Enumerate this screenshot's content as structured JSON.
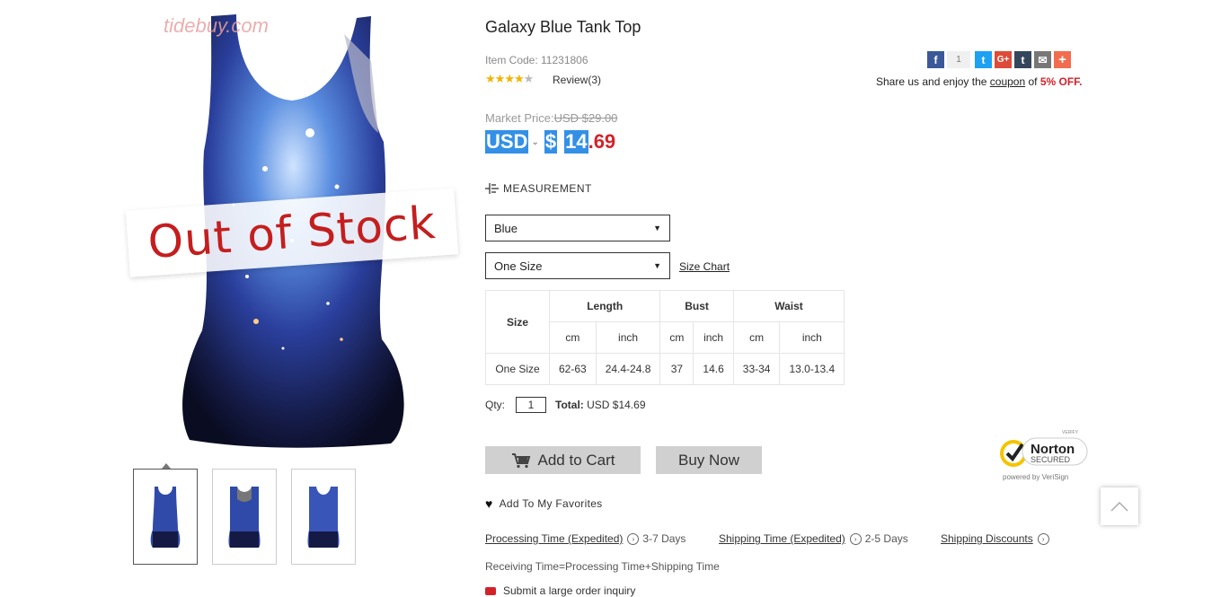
{
  "product": {
    "title": "Galaxy Blue Tank Top",
    "item_code": "Item Code: 11231806",
    "review_label": "Review(3)",
    "rating": 4,
    "rating_max": 5,
    "watermark": "tidebuy.com",
    "stock_banner": "Out of Stock"
  },
  "price": {
    "market_label": "Market Price:",
    "market_value": "USD $29.00",
    "currency": "USD",
    "symbol": "$",
    "integer": "14",
    "decimal": ".69",
    "accent_color": "#d2232a"
  },
  "measurement": {
    "label": "MEASUREMENT"
  },
  "options": {
    "color_value": "Blue",
    "size_value": "One Size",
    "size_chart_link": "Size Chart"
  },
  "size_table": {
    "size_header": "Size",
    "groups": [
      "Length",
      "Bust",
      "Waist"
    ],
    "units": [
      "cm",
      "inch",
      "cm",
      "inch",
      "cm",
      "inch"
    ],
    "rows": [
      {
        "size": "One Size",
        "values": [
          "62-63",
          "24.4-24.8",
          "37",
          "14.6",
          "33-34",
          "13.0-13.4"
        ]
      }
    ]
  },
  "order": {
    "qty_label": "Qty:",
    "qty_value": "1",
    "total_label": "Total:",
    "total_value": " USD $14.69",
    "add_to_cart": "Add to Cart",
    "buy_now": "Buy Now",
    "favorites": "Add To My Favorites"
  },
  "shipping": {
    "processing_label": "Processing Time (Expedited)",
    "processing_days": "3-7 Days",
    "shipping_label": "Shipping Time (Expedited)",
    "shipping_days": "2-5 Days",
    "discounts_label": "Shipping Discounts",
    "receiving_note": "Receiving Time=Processing Time+Shipping Time",
    "inquiry": "Submit a large order inquiry"
  },
  "share": {
    "count": "1",
    "text_before": "Share us and enjoy the ",
    "coupon_link": "coupon",
    "text_mid": " of ",
    "discount": "5% OFF.",
    "icons": [
      {
        "name": "facebook-icon",
        "glyph": "f",
        "color": "#3b5998"
      },
      {
        "name": "twitter-icon",
        "glyph": "t",
        "color": "#1da1f2"
      },
      {
        "name": "google-plus-icon",
        "glyph": "G+",
        "color": "#dd4b39"
      },
      {
        "name": "tumblr-icon",
        "glyph": "t",
        "color": "#35465c"
      },
      {
        "name": "email-icon",
        "glyph": "✉",
        "color": "#777777"
      },
      {
        "name": "more-share-icon",
        "glyph": "+",
        "color": "#f26c4f"
      }
    ]
  },
  "norton": {
    "verify": "VERIFY",
    "brand": "Norton",
    "secured": "SECURED",
    "powered": "powered by VeriSign"
  }
}
